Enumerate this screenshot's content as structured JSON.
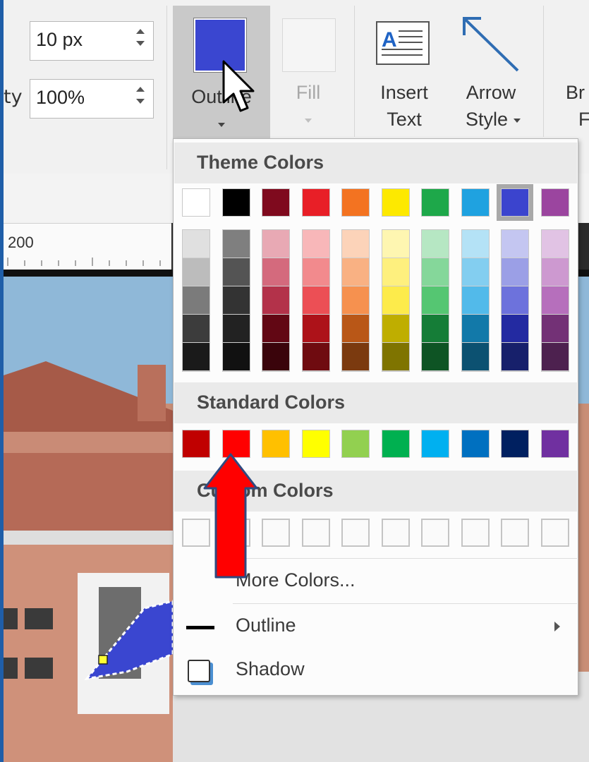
{
  "ribbon": {
    "size_left_label": "",
    "size_value": "10 px",
    "opacity_left_label": "ty",
    "opacity_value": "100%",
    "outline_label": "Outline",
    "outline_color": "#3a46d0",
    "fill_label": "Fill",
    "insert_text_line1": "Insert",
    "insert_text_line2": "Text",
    "arrow_style_line1": "Arrow",
    "arrow_style_line2": "Style",
    "cut_off_line1": "Br",
    "cut_off_line2": "F"
  },
  "ruler": {
    "label": "200"
  },
  "dropdown": {
    "theme_header": "Theme Colors",
    "theme_top": [
      "#ffffff",
      "#000000",
      "#7f0a1e",
      "#e81f27",
      "#f37321",
      "#fde900",
      "#1ea84a",
      "#1fa2e0",
      "#3b44ce",
      "#9b459f"
    ],
    "theme_shades": [
      [
        "#e0e0e0",
        "#bcbcbc",
        "#7b7b7b",
        "#3c3c3c",
        "#1a1a1a"
      ],
      [
        "#7f7f7f",
        "#545454",
        "#333333",
        "#222222",
        "#111111"
      ],
      [
        "#e8a9b4",
        "#d46a7d",
        "#b3324a",
        "#620714",
        "#3a040b"
      ],
      [
        "#f8b7b9",
        "#f28a8d",
        "#ec4f55",
        "#ad1219",
        "#6f0b10"
      ],
      [
        "#fcd3b9",
        "#f9b183",
        "#f6914f",
        "#b95717",
        "#7b3a0f"
      ],
      [
        "#fef6b1",
        "#fef07e",
        "#fdeb4b",
        "#bfae00",
        "#7f7400"
      ],
      [
        "#b6e7c3",
        "#85d79a",
        "#55c672",
        "#157d37",
        "#0e5424"
      ],
      [
        "#b4e2f6",
        "#83cef0",
        "#52baea",
        "#1279a9",
        "#0c5171"
      ],
      [
        "#c4c6f1",
        "#9b9fe6",
        "#6d72dc",
        "#232aa1",
        "#17206b"
      ],
      [
        "#e1c3e4",
        "#cd99d0",
        "#b66fbc",
        "#733176",
        "#4d214f"
      ]
    ],
    "standard_header": "Standard Colors",
    "standard": [
      "#c00000",
      "#ff0000",
      "#ffc000",
      "#ffff00",
      "#92d050",
      "#00b050",
      "#00b0f0",
      "#0070c0",
      "#002060",
      "#7030a0"
    ],
    "custom_header": "Custom Colors",
    "more_colors": "More Colors...",
    "outline_item": "Outline",
    "shadow_item": "Shadow"
  }
}
